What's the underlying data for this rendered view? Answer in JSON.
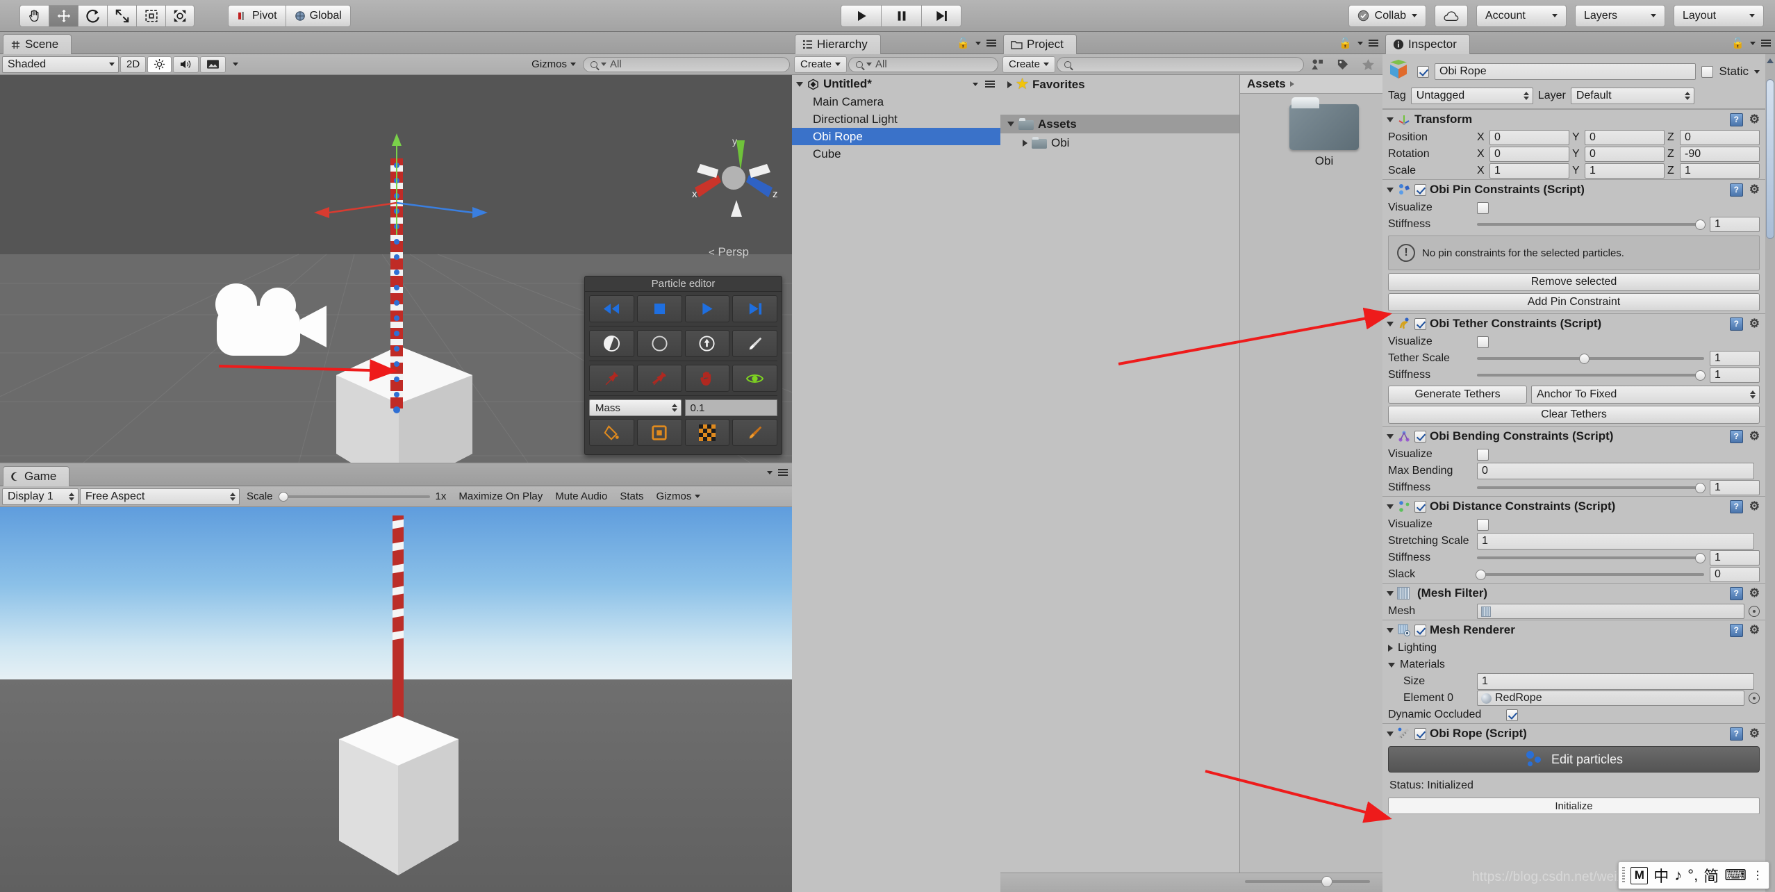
{
  "toolbar": {
    "transform_tools": [
      {
        "name": "hand-tool",
        "selected": false
      },
      {
        "name": "move-tool",
        "selected": true
      },
      {
        "name": "rotate-tool",
        "selected": false
      },
      {
        "name": "scale-tool",
        "selected": false
      },
      {
        "name": "rect-tool",
        "selected": false
      },
      {
        "name": "transform-tool",
        "selected": false
      }
    ],
    "pivot_label": "Pivot",
    "global_label": "Global",
    "play_label": "play-icon",
    "pause_label": "pause-icon",
    "step_label": "step-icon",
    "collab_label": "Collab",
    "cloud_label": "cloud-icon",
    "account_label": "Account",
    "layers_label": "Layers",
    "layout_label": "Layout"
  },
  "scene": {
    "tab_label": "Scene",
    "draw_mode": "Shaded",
    "two_d": "2D",
    "gizmos_label": "Gizmos",
    "search_placeholder": "All",
    "gizmo_axes": {
      "x": "x",
      "y": "y",
      "z": "z"
    },
    "persp_label": "Persp"
  },
  "game": {
    "tab_label": "Game",
    "display": "Display 1",
    "aspect": "Free Aspect",
    "scale_label": "Scale",
    "scale_value": "1x",
    "maximize_label": "Maximize On Play",
    "mute_label": "Mute Audio",
    "stats_label": "Stats",
    "gizmos_label": "Gizmos"
  },
  "particle_editor": {
    "title": "Particle editor",
    "row1": [
      "rewind-icon",
      "stop-icon",
      "play-icon",
      "step-forward-icon"
    ],
    "row2": [
      "half-circle-icon",
      "circle-icon",
      "target-circle-icon",
      "white-brush-icon"
    ],
    "row3": [
      "pin-icon",
      "unpin-icon",
      "hand-icon",
      "eye-icon"
    ],
    "property_label": "Mass",
    "property_value": "0.1",
    "row4": [
      "paint-bucket-icon",
      "square-select-icon",
      "checker-icon",
      "orange-brush-icon"
    ]
  },
  "hierarchy": {
    "tab_label": "Hierarchy",
    "create_label": "Create",
    "search_placeholder": "All",
    "scene_name": "Untitled*",
    "items": [
      {
        "label": "Main Camera",
        "selected": false
      },
      {
        "label": "Directional Light",
        "selected": false
      },
      {
        "label": "Obi Rope",
        "selected": true
      },
      {
        "label": "Cube",
        "selected": false
      }
    ]
  },
  "project": {
    "tab_label": "Project",
    "create_label": "Create",
    "search_placeholder": "",
    "favorites_label": "Favorites",
    "tree": [
      {
        "label": "Assets",
        "selected": true,
        "indent": 0
      },
      {
        "label": "Obi",
        "selected": false,
        "indent": 1
      }
    ],
    "breadcrumb": "Assets",
    "asset_tile_label": "Obi"
  },
  "inspector": {
    "tab_label": "Inspector",
    "object_name": "Obi Rope",
    "object_enabled": true,
    "static_label": "Static",
    "tag_label": "Tag",
    "tag_value": "Untagged",
    "layer_label": "Layer",
    "layer_value": "Default",
    "components": [
      {
        "title": "Transform",
        "has_checkbox": false,
        "icon": "transform-axis-icon",
        "rows": [
          {
            "type": "vec3",
            "label": "Position",
            "x": "0",
            "y": "0",
            "z": "0"
          },
          {
            "type": "vec3",
            "label": "Rotation",
            "x": "0",
            "y": "0",
            "z": "-90"
          },
          {
            "type": "vec3",
            "label": "Scale",
            "x": "1",
            "y": "1",
            "z": "1"
          }
        ]
      },
      {
        "title": "Obi Pin Constraints (Script)",
        "has_checkbox": true,
        "enabled": true,
        "icon": "obi-pin-icon",
        "rows": [
          {
            "type": "checkbox",
            "label": "Visualize",
            "checked": false
          },
          {
            "type": "slider",
            "label": "Stiffness",
            "value": "1",
            "fill": 1.0
          },
          {
            "type": "help",
            "text": "No pin constraints for the selected particles."
          },
          {
            "type": "button",
            "label": "Remove selected"
          },
          {
            "type": "button",
            "label": "Add Pin Constraint"
          }
        ]
      },
      {
        "title": "Obi Tether Constraints (Script)",
        "has_checkbox": true,
        "enabled": true,
        "icon": "obi-tether-icon",
        "rows": [
          {
            "type": "checkbox",
            "label": "Visualize",
            "checked": false
          },
          {
            "type": "slider",
            "label": "Tether Scale",
            "value": "1",
            "fill": 0.46
          },
          {
            "type": "slider",
            "label": "Stiffness",
            "value": "1",
            "fill": 1.0
          },
          {
            "type": "button_dropdown",
            "button_label": "Generate Tethers",
            "dropdown_value": "Anchor To Fixed"
          },
          {
            "type": "button",
            "label": "Clear Tethers"
          }
        ]
      },
      {
        "title": "Obi Bending Constraints (Script)",
        "has_checkbox": true,
        "enabled": true,
        "icon": "obi-bending-icon",
        "rows": [
          {
            "type": "checkbox",
            "label": "Visualize",
            "checked": false
          },
          {
            "type": "field",
            "label": "Max Bending",
            "value": "0"
          },
          {
            "type": "slider",
            "label": "Stiffness",
            "value": "1",
            "fill": 1.0
          }
        ]
      },
      {
        "title": "Obi Distance Constraints (Script)",
        "has_checkbox": true,
        "enabled": true,
        "icon": "obi-distance-icon",
        "rows": [
          {
            "type": "checkbox",
            "label": "Visualize",
            "checked": false
          },
          {
            "type": "field",
            "label": "Stretching Scale",
            "value": "1"
          },
          {
            "type": "slider",
            "label": "Stiffness",
            "value": "1",
            "fill": 1.0
          },
          {
            "type": "slider",
            "label": "Slack",
            "value": "0",
            "fill": 0.0
          }
        ]
      },
      {
        "title": "(Mesh Filter)",
        "has_checkbox": false,
        "icon": "mesh-filter-icon",
        "rows": [
          {
            "type": "object",
            "label": "Mesh",
            "value": "",
            "obj_icon": "mesh-icon"
          }
        ]
      },
      {
        "title": "Mesh Renderer",
        "has_checkbox": true,
        "enabled": true,
        "icon": "mesh-renderer-icon",
        "rows": [
          {
            "type": "foldout",
            "label": "Lighting",
            "open": false
          },
          {
            "type": "foldout",
            "label": "Materials",
            "open": true
          },
          {
            "type": "field_ind",
            "label": "Size",
            "value": "1"
          },
          {
            "type": "object_ind",
            "label": "Element 0",
            "value": "RedRope",
            "obj_icon": "material-sphere-icon"
          },
          {
            "type": "checkbox",
            "label": "Dynamic Occluded",
            "checked": true
          }
        ]
      },
      {
        "title": "Obi Rope (Script)",
        "has_checkbox": true,
        "enabled": true,
        "icon": "obi-rope-icon",
        "rows": [
          {
            "type": "editparticles",
            "label": "Edit particles"
          },
          {
            "type": "status",
            "label": "Status: Initialized"
          },
          {
            "type": "initbtn",
            "label": "Initialize"
          }
        ]
      }
    ]
  },
  "ime": {
    "mode": "M",
    "chinese": "中",
    "note": "♪",
    "punct": "°,",
    "simplified": "简",
    "keyboard": "⌨",
    "more": "⋮"
  },
  "watermark": "https://blog.csdn.net/weixin_14",
  "colors": {
    "accent_blue": "#3a72c9",
    "panel_bg": "#c2c2c2",
    "toolbar_bg": "#a9a9a9",
    "arrow_red": "#ee1b1b",
    "rope_red": "#c02b26"
  }
}
